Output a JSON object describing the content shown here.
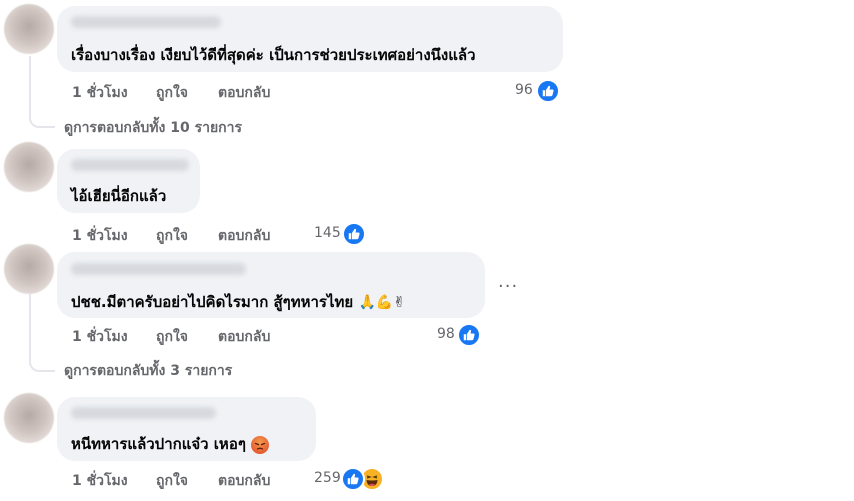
{
  "comments": [
    {
      "text": "เรื่องบางเรื่อง เงียบไว้ดีที่สุดค่ะ เป็นการช่วยประเทศอย่างนึงแล้ว",
      "time": "1 ชั่วโมง",
      "like": "ถูกใจ",
      "reply": "ตอบกลับ",
      "reactions": "96",
      "replies_link": "ดูการตอบกลับทั้ง 10 รายการ"
    },
    {
      "text": "ไอ้เฮียนี่อีกแล้ว",
      "time": "1 ชั่วโมง",
      "like": "ถูกใจ",
      "reply": "ตอบกลับ",
      "reactions": "145"
    },
    {
      "text": "ปชช.มีตาครับอย่าไปคิดไรมาก สู้ๆทหารไทย",
      "emojis": "🙏💪✌",
      "time": "1 ชั่วโมง",
      "like": "ถูกใจ",
      "reply": "ตอบกลับ",
      "reactions": "98",
      "more": "···",
      "replies_link": "ดูการตอบกลับทั้ง 3 รายการ"
    },
    {
      "text": "หนีทหารแล้วปากแจ๋ว เหอๆ",
      "time": "1 ชั่วโมง",
      "like": "ถูกใจ",
      "reply": "ตอบกลับ",
      "reactions": "259"
    }
  ],
  "icons": {
    "like": "like-icon",
    "haha": "haha-icon",
    "angry": "angry-emoji-icon",
    "more": "more-icon"
  },
  "colors": {
    "bubble": "#f0f2f5",
    "like_blue": "#1877f2",
    "meta_gray": "#65676b"
  }
}
